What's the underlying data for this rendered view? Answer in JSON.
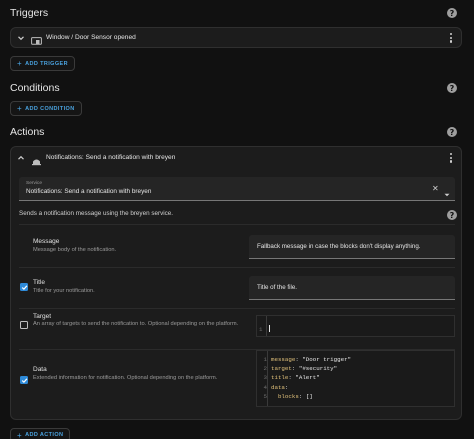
{
  "triggers": {
    "title": "Triggers",
    "item_label": "Window / Door Sensor opened",
    "add_label": "ADD TRIGGER"
  },
  "conditions": {
    "title": "Conditions",
    "add_label": "ADD CONDITION"
  },
  "actions": {
    "title": "Actions",
    "item_label": "Notifications: Send a notification with breyen",
    "service_field_label": "Service",
    "service_value": "Notifications: Send a notification with breyen",
    "description": "Sends a notification message using the breyen service.",
    "add_label": "ADD ACTION",
    "fields": [
      {
        "label": "Message",
        "desc": "Message body of the notification.",
        "value": "Fallback message in case the blocks don't display anything."
      },
      {
        "label": "Title",
        "desc": "Title for your notification.",
        "value": "Title of the file."
      },
      {
        "label": "Target",
        "desc": "An array of targets to send the notification to. Optional depending on the platform.",
        "line_no": "1"
      },
      {
        "label": "Data",
        "desc": "Extended information for notification. Optional depending on the platform."
      }
    ],
    "code": [
      {
        "n": "1",
        "key": "message",
        "val": "\"Door trigger\""
      },
      {
        "n": "2",
        "key": "target",
        "val": "\"#security\""
      },
      {
        "n": "3",
        "key": "title",
        "val": "\"Alert\""
      },
      {
        "n": "4",
        "key": "data",
        "val": ""
      },
      {
        "n": "5",
        "key": "  blocks",
        "val": "[]"
      }
    ]
  },
  "colors": {
    "accent": "#4aa3e0",
    "checkbox": "#2e8ad8",
    "background": "#111111",
    "card": "#1c1c1c"
  }
}
